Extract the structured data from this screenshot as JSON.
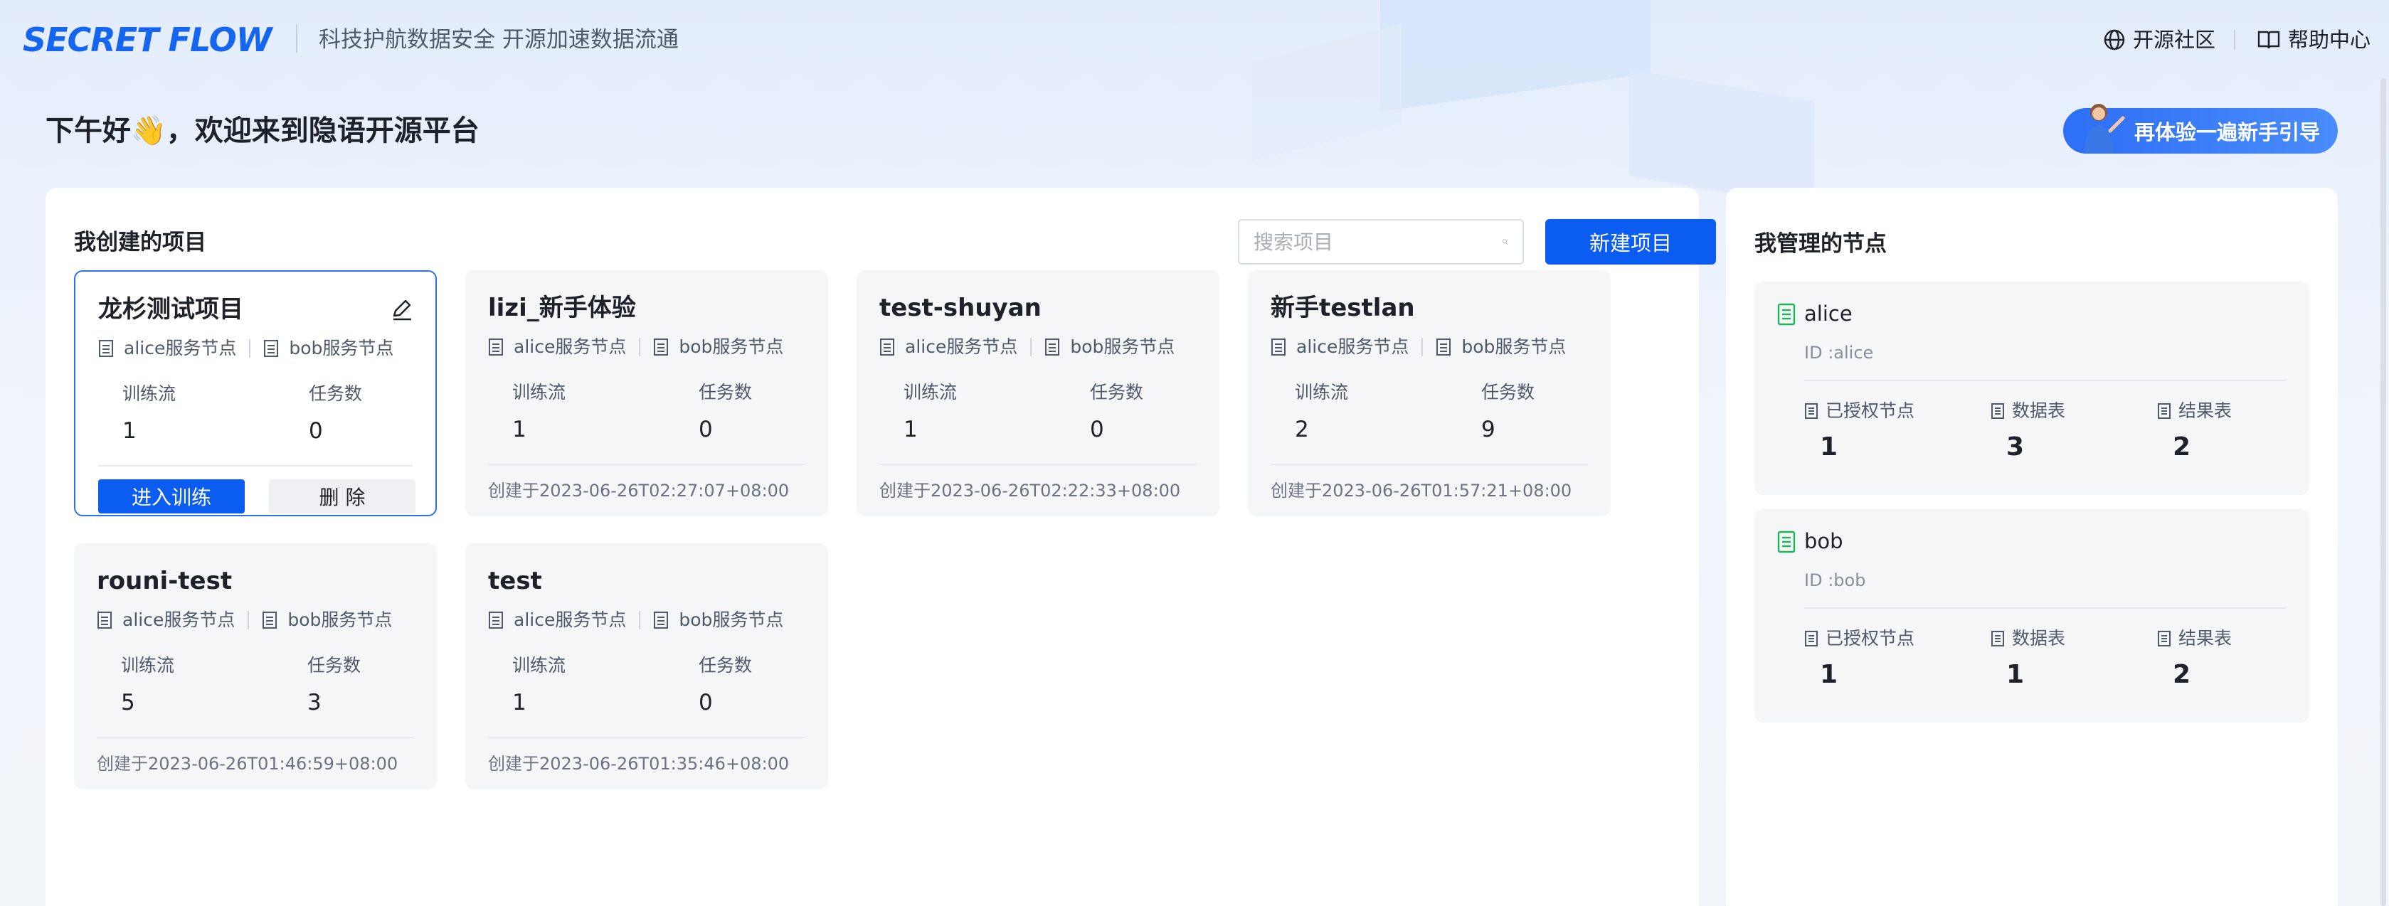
{
  "header": {
    "logo_part1": "SECRET",
    "logo_part2": "FLOW",
    "slogan": "科技护航数据安全 开源加速数据流通",
    "community": "开源社区",
    "help": "帮助中心"
  },
  "greeting": "下午好👋，欢迎来到隐语开源平台",
  "guide_button": "再体验一遍新手引导",
  "projects": {
    "title": "我创建的项目",
    "search_placeholder": "搜索项目",
    "new_button": "新建项目",
    "enter_label": "进入训练",
    "delete_label": "删 除",
    "flow_label": "训练流",
    "task_label": "任务数",
    "items": [
      {
        "name": "龙杉测试项目",
        "node_a": "alice服务节点",
        "node_b": "bob服务节点",
        "flows": "1",
        "tasks": "0",
        "created": ""
      },
      {
        "name": "lizi_新手体验",
        "node_a": "alice服务节点",
        "node_b": "bob服务节点",
        "flows": "1",
        "tasks": "0",
        "created": "创建于2023-06-26T02:27:07+08:00"
      },
      {
        "name": "test-shuyan",
        "node_a": "alice服务节点",
        "node_b": "bob服务节点",
        "flows": "1",
        "tasks": "0",
        "created": "创建于2023-06-26T02:22:33+08:00"
      },
      {
        "name": "新手testlan",
        "node_a": "alice服务节点",
        "node_b": "bob服务节点",
        "flows": "2",
        "tasks": "9",
        "created": "创建于2023-06-26T01:57:21+08:00"
      },
      {
        "name": "rouni-test",
        "node_a": "alice服务节点",
        "node_b": "bob服务节点",
        "flows": "5",
        "tasks": "3",
        "created": "创建于2023-06-26T01:46:59+08:00"
      },
      {
        "name": "test",
        "node_a": "alice服务节点",
        "node_b": "bob服务节点",
        "flows": "1",
        "tasks": "0",
        "created": "创建于2023-06-26T01:35:46+08:00"
      }
    ]
  },
  "nodes": {
    "title": "我管理的节点",
    "auth_label": "已授权节点",
    "table_label": "数据表",
    "result_label": "结果表",
    "items": [
      {
        "name": "alice",
        "id": "ID :alice",
        "auth": "1",
        "tables": "3",
        "results": "2"
      },
      {
        "name": "bob",
        "id": "ID :bob",
        "auth": "1",
        "tables": "1",
        "results": "2"
      }
    ]
  },
  "colors": {
    "primary": "#0b5cf0",
    "node_icon": "#1fb35a"
  }
}
